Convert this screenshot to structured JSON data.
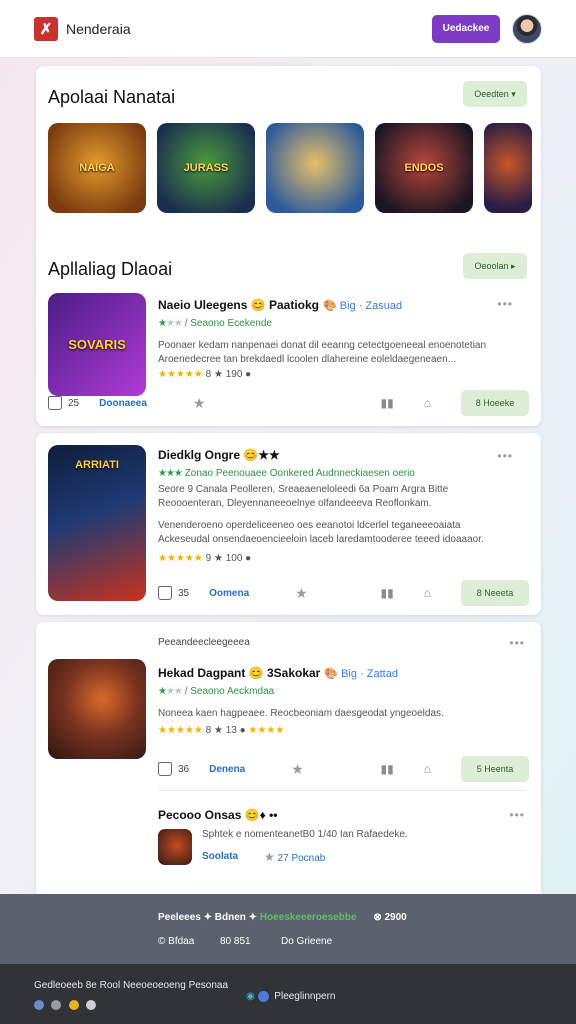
{
  "header": {
    "brand": "Nenderaia",
    "logo_glyph": "✗",
    "cta_label": "Uedackee"
  },
  "featured": {
    "title": "Apolaai Nanatai",
    "button": "Oeedten ▾",
    "thumbs": [
      {
        "caption": "NAIGA",
        "c1": "#7a3b10",
        "c2": "#e39a2c"
      },
      {
        "caption": "JURASS",
        "c1": "#1b2e4f",
        "c2": "#4a9a3c"
      },
      {
        "caption": "",
        "c1": "#2c5a9a",
        "c2": "#e7c06a"
      },
      {
        "caption": "ENDOS",
        "c1": "#1a1622",
        "c2": "#b8463c"
      },
      {
        "caption": "",
        "c1": "#2a1d44",
        "c2": "#c7552a"
      }
    ]
  },
  "apps_section": {
    "title": "Apllaliag Dlaoai",
    "button": "Oeoolan ▸"
  },
  "apps": [
    {
      "title": "Naeio Uleegens 😊 Paatiokg",
      "tag": "🎨 Big · Zasuad",
      "rating_text": "/ Seaono  Ecekende",
      "stars_green": "★",
      "stars_grey": "★★",
      "desc1": "Poonaer kedam nanpenaei donat dil eeanng cetectgoeneeal enoenotetian",
      "desc2": "Aroenedecree tan brekdaedl lcoolen dlahereine eoleldaegeneaen...",
      "gold_stars": "★★★★★",
      "gold_num": "8 ★ 190 ●",
      "likes": "25",
      "link": "Doonaeea",
      "action": "8 Hoeeke",
      "icon_c1": "#4b1d86",
      "icon_c2": "#b03bd6",
      "icon_label": "SOVARIS"
    },
    {
      "title": "Diedklg Ongre 😊★★",
      "tag": "",
      "rating_text": "Zonao  Peenouaee  Oonkered Audnneckiaesen oerio",
      "stars_green": "★★★",
      "stars_grey": "",
      "desc1": "Seore 9 Canala Peolleren, Sreaeaeneloleedi 6a Poam Argra Bitte",
      "desc2": "Reoooenteran, Dleyennaneeoelnye olfandeeeva Reoflonkam.",
      "desc3": "Venenderoeno operdeliceeneo oes eeanotoi ldcerlel teganeeeoaiata",
      "desc4": "Ackeseudal onsendaeoencieeloin laceb laredamtooderee teeed idoaaaor.",
      "gold_stars": "★★★★★",
      "gold_num": "9 ★ 100 ●",
      "likes": "35",
      "link": "Oomena",
      "action": "8 Neeeta",
      "icon_c1": "#0e1d3c",
      "icon_c2": "#c9331d",
      "icon_label": "ARRIATI"
    },
    {
      "pre_label": "Peeandeecleegeeea",
      "title": "Hekad Dagpant 😊 3Sakokar",
      "tag": "🎨 Big · Zattad",
      "rating_text": "/ Seaono  Aeckmdaa",
      "stars_green": "★",
      "stars_grey": "★★",
      "desc1": "Noneea kaen hagpeaee. Reocbeoniam daesgeodat yngeoeldas.",
      "gold_stars": "★★★★★",
      "gold_num": "8 ★ 13 ●",
      "gold_extra": "★★★★",
      "likes": "36",
      "link": "Denena",
      "action": "5 Heenta",
      "icon_c1": "#4a2316",
      "icon_c2": "#d96a2a",
      "icon_label": ""
    }
  ],
  "mini_app": {
    "title": "Pecooo Onsas 😊♦ ••",
    "desc": "Sphtek e nomenteanetB0 1/40 Ian Rafaedeke.",
    "link": "Soolata",
    "rating": "27 Pocnab",
    "icon_c1": "#2a1a12",
    "icon_c2": "#c74a22"
  },
  "footer": {
    "line1": "Peeleees ✦ Bdnen ✦ ",
    "line1_green": "Hoeeskeeeroesebbe",
    "line1_end": "⊗ 2900",
    "line2_a": "© Bfdaa",
    "line2_b": "80 851",
    "line2_c": "Do Grieene",
    "line3": "Gedleoeeb 8e  Rool  Neeoeoeoeng  Pesonaa",
    "line3_right": "Pleeglinnpern"
  }
}
